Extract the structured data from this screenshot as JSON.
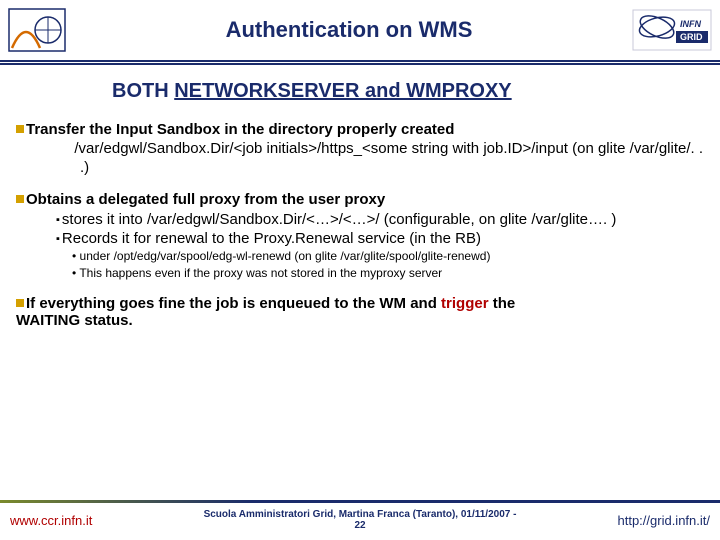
{
  "header": {
    "title": "Authentication on WMS"
  },
  "subtitle": {
    "part1": "BOTH ",
    "underlined": "NETWORKSERVER and WMPROXY"
  },
  "s1": {
    "head": "Transfer the Input Sandbox in the directory properly created",
    "body": "/var/edgwl/Sandbox.Dir/<job initials>/https_<some string with job.ID>/input (on glite /var/glite/. . .)"
  },
  "s2": {
    "head": "Obtains a delegated full proxy from the user proxy",
    "sub1": "stores it into /var/edgwl/Sandbox.Dir/<…>/<…>/ (configurable, on glite /var/glite…. )",
    "sub2": "Records it for renewal to the Proxy.Renewal service (in the RB)",
    "b1": "under /opt/edg/var/spool/edg-wl-renewd (on glite /var/glite/spool/glite-renewd)",
    "b2": "This happens even if the proxy was not stored in the myproxy server"
  },
  "s3": {
    "line1": "If everything goes fine the job is enqueued to the WM and ",
    "trigger": "trigger",
    "line2": " the ",
    "waiting": "WAITING status."
  },
  "footer": {
    "left": "www.ccr.infn.it",
    "center_l1": "Scuola Amministratori Grid, Martina Franca (Taranto), 01/11/2007  -",
    "center_l2": "22",
    "right": "http://grid.infn.it/"
  }
}
